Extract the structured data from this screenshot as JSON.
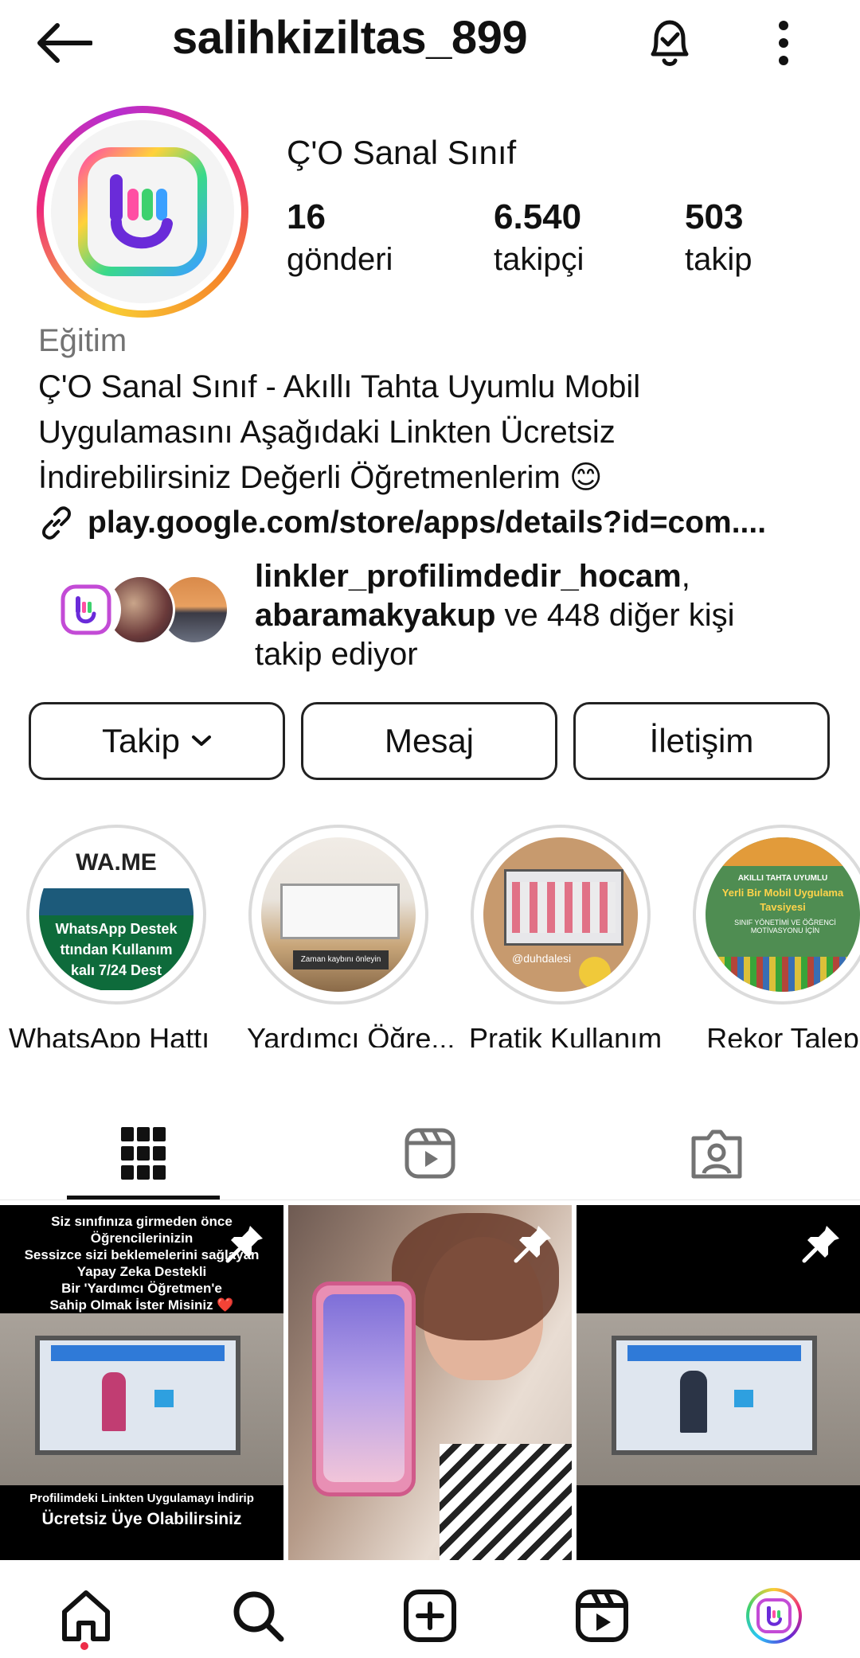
{
  "header": {
    "username": "salihkiziltas_899",
    "icons": {
      "back": "arrow-left-icon",
      "notifications": "bell-check-icon",
      "more": "vertical-dots-icon"
    }
  },
  "profile": {
    "display_name": "Ç'O Sanal Sınıf",
    "stats": {
      "posts": {
        "value": "16",
        "label": "gönderi"
      },
      "followers": {
        "value": "6.540",
        "label": "takipçi"
      },
      "following": {
        "value": "503",
        "label": "takip"
      }
    },
    "category": "Eğitim",
    "bio_lines": [
      "Ç'O Sanal Sınıf - Akıllı Tahta Uyumlu Mobil",
      "Uygulamasını Aşağıdaki Linkten Ücretsiz",
      "İndirebilirsiniz Değerli Öğretmenlerim 😊"
    ],
    "link": "play.google.com/store/apps/details?id=com...."
  },
  "mutual": {
    "user1": "linkler_profilimdedir_hocam",
    "sep": ",",
    "user2": "abaramakyakup",
    "rest_line": " ve 448 diğer kişi",
    "line3": "takip ediyor"
  },
  "actions": {
    "follow": "Takip",
    "message": "Mesaj",
    "contact": "İletişim"
  },
  "highlights": [
    {
      "label": "WhatsApp Hattı",
      "text1": "WA.ME",
      "text2": "WhatsApp Destek",
      "text3": "ttından Kullanım",
      "text4": "kalı 7/24 Dest"
    },
    {
      "label": "Yardımcı Öğre...",
      "text1": "Zaman kaybını önleyin"
    },
    {
      "label": "Pratik Kullanım",
      "text1": "@duhdalesi"
    },
    {
      "label": "Rekor Talep",
      "text1": "AKILLI TAHTA UYUMLU",
      "text2": "Yerli Bir Mobil Uygulama",
      "text3": "Tavsiyesi",
      "text4": "SINIF YÖNETİMİ VE ÖĞRENCİ MOTİVASYONU İÇİN"
    }
  ],
  "tabs": [
    {
      "name": "posts",
      "icon": "grid-icon"
    },
    {
      "name": "reels",
      "icon": "reels-icon"
    },
    {
      "name": "tagged",
      "icon": "tagged-person-icon"
    }
  ],
  "posts": [
    {
      "pinned": true,
      "top_caption": [
        "Siz sınıfınıza girmeden önce",
        "Öğrencilerinizin",
        "Sessizce sizi beklemelerini sağlayan",
        "Yapay Zeka Destekli",
        "Bir 'Yardımcı Öğretmen'e",
        "Sahip Olmak İster Misiniz ❤️"
      ],
      "bottom_caption": [
        "Profilimdeki Linkten Uygulamayı İndirip",
        "Ücretsiz Üye Olabilirsiniz"
      ]
    },
    {
      "pinned": true
    },
    {
      "pinned": true
    }
  ],
  "bottom_nav": [
    {
      "name": "home",
      "icon": "home-icon",
      "active": true
    },
    {
      "name": "search",
      "icon": "search-icon"
    },
    {
      "name": "create",
      "icon": "plus-square-icon"
    },
    {
      "name": "reels",
      "icon": "reels-icon"
    },
    {
      "name": "profile",
      "icon": "profile-avatar-icon"
    }
  ],
  "colors": {
    "story_ring": "#ee2a7b",
    "notification_dot": "#ed2c48",
    "text": "#111111",
    "muted": "#737373"
  }
}
